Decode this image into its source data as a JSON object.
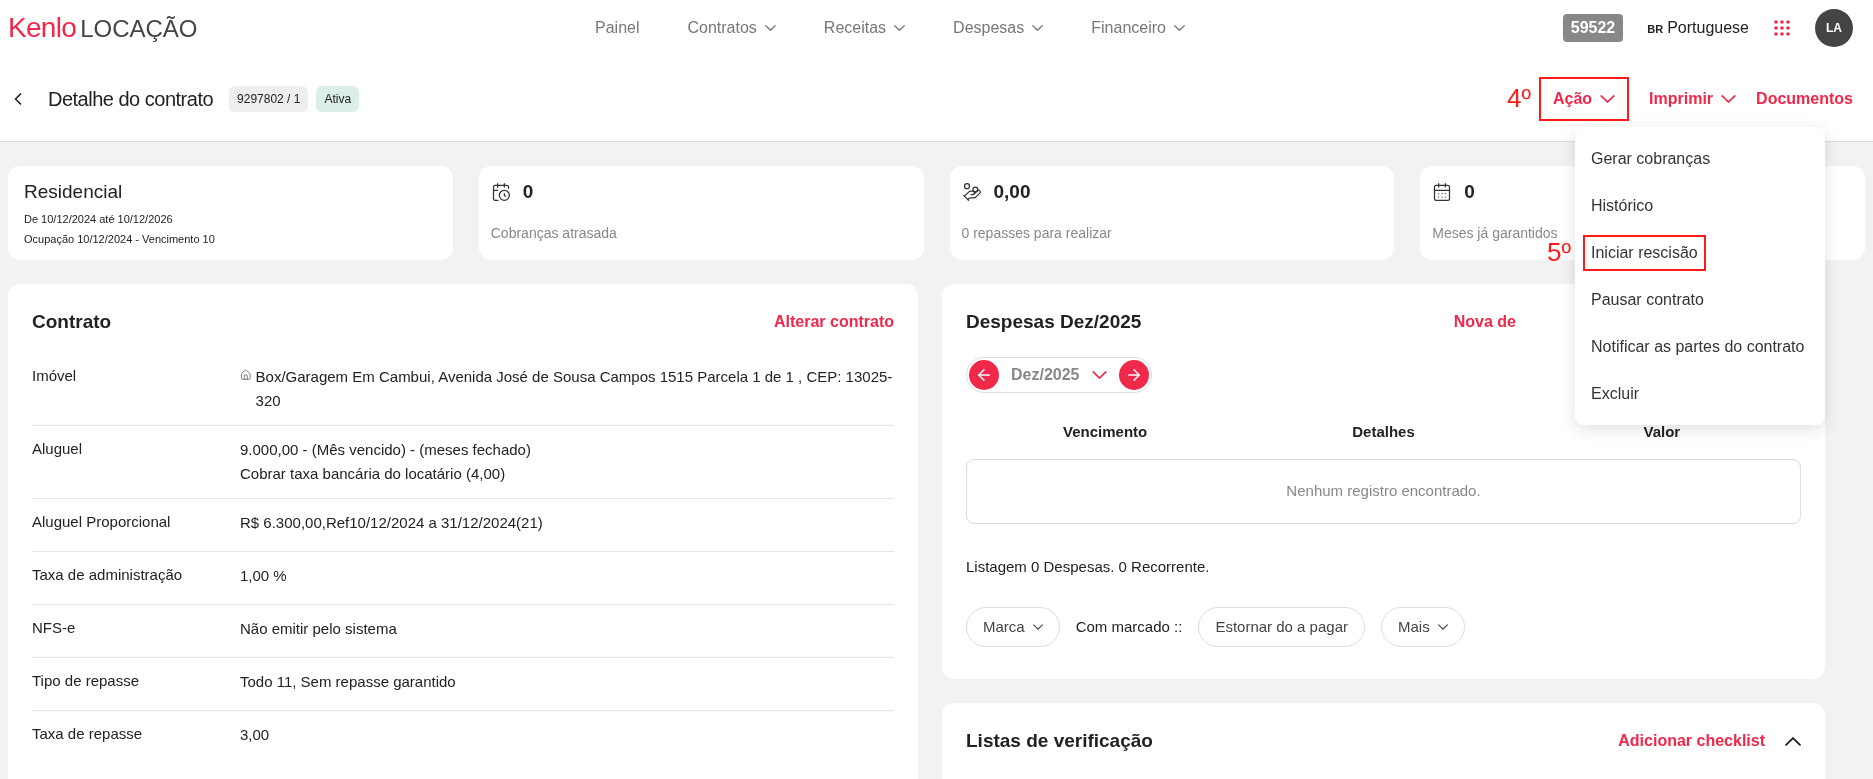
{
  "logo": {
    "brand": "Kenlo",
    "product": "LOCAÇÃO"
  },
  "nav": [
    {
      "label": "Painel",
      "dropdown": false
    },
    {
      "label": "Contratos",
      "dropdown": true
    },
    {
      "label": "Receitas",
      "dropdown": true
    },
    {
      "label": "Despesas",
      "dropdown": true
    },
    {
      "label": "Financeiro",
      "dropdown": true
    }
  ],
  "header_right": {
    "code": "59522",
    "language_flag": "BR",
    "language": "Portuguese",
    "avatar": "LA"
  },
  "page": {
    "title": "Detalhe do contrato",
    "contract_number": "9297802 / 1",
    "status": "Ativa"
  },
  "actions": [
    {
      "label": "Ação",
      "dropdown": true,
      "highlighted": true,
      "step": "4º"
    },
    {
      "label": "Imprimir",
      "dropdown": true,
      "highlighted": false
    },
    {
      "label": "Documentos",
      "dropdown": false,
      "highlighted": false
    }
  ],
  "action_menu": [
    {
      "label": "Gerar cobranças",
      "highlighted": false
    },
    {
      "label": "Histórico",
      "highlighted": false
    },
    {
      "label": "Iniciar rescisão",
      "highlighted": true,
      "step": "5º"
    },
    {
      "label": "Pausar contrato",
      "highlighted": false
    },
    {
      "label": "Notificar as partes do contrato",
      "highlighted": false
    },
    {
      "label": "Excluir",
      "highlighted": false
    }
  ],
  "summary_cards": [
    {
      "kind": "info",
      "title": "Residencial",
      "lines": [
        "De 10/12/2024 até 10/12/2026",
        "Ocupação 10/12/2024 - Vencimento 10"
      ]
    },
    {
      "kind": "stat",
      "value": "0",
      "label": "Cobranças atrasada"
    },
    {
      "kind": "stat",
      "value": "0,00",
      "label": "0 repasses para realizar"
    },
    {
      "kind": "stat",
      "value": "0",
      "label": "Meses já garantidos"
    }
  ],
  "contract": {
    "title": "Contrato",
    "link": "Alterar contrato",
    "rows": [
      {
        "label": "Imóvel",
        "home_icon": true,
        "value": [
          "Box/Garagem Em Cambui, Avenida José de Sousa Campos 1515 Parcela 1 de 1 , CEP: 13025-320"
        ]
      },
      {
        "label": "Aluguel",
        "home_icon": false,
        "value": [
          "9.000,00 - (Mês vencido) - (meses fechado)",
          "Cobrar taxa bancária do locatário (4,00)"
        ]
      },
      {
        "label": "Aluguel Proporcional",
        "home_icon": false,
        "value": [
          "R$ 6.300,00,Ref10/12/2024 a 31/12/2024(21)"
        ]
      },
      {
        "label": "Taxa de administração",
        "home_icon": false,
        "value": [
          "1,00 %"
        ]
      },
      {
        "label": "NFS-e",
        "home_icon": false,
        "value": [
          "Não emitir pelo sistema"
        ]
      },
      {
        "label": "Tipo de repasse",
        "home_icon": false,
        "value": [
          "Todo 11, Sem repasse garantido"
        ]
      },
      {
        "label": "Taxa de repasse",
        "home_icon": false,
        "value": [
          "3,00"
        ]
      }
    ]
  },
  "expenses": {
    "title": "Despesas Dez/2025",
    "link": "Nova de",
    "month": "Dez/2025",
    "columns": [
      "Vencimento",
      "Detalhes",
      "Valor"
    ],
    "empty": "Nenhum registro encontrado.",
    "summary": "Listagem 0 Despesas. 0 Recorrente.",
    "mark_button": "Marca",
    "with_marked": "Com marcado ::",
    "reverse_button": "Estornar do a pagar",
    "more_button": "Mais"
  },
  "checklists": {
    "title": "Listas de verificação",
    "link": "Adicionar checklist",
    "expanded": true
  }
}
